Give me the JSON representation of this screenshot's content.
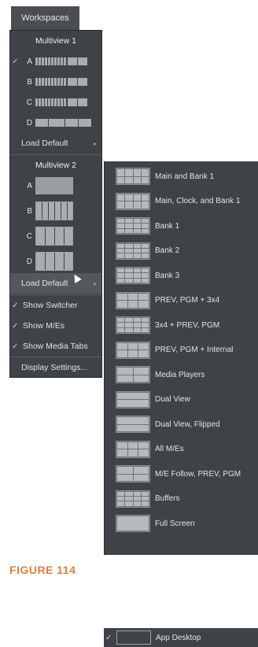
{
  "workspaces_button": "Workspaces",
  "multiview1": {
    "title": "Multiview 1",
    "rows": [
      {
        "check": "✓",
        "letter": "A"
      },
      {
        "check": "",
        "letter": "B"
      },
      {
        "check": "",
        "letter": "C"
      },
      {
        "check": "",
        "letter": "D"
      }
    ],
    "load_default": "Load Default"
  },
  "multiview2": {
    "title": "Multiview 2",
    "rows": [
      {
        "letter": "A"
      },
      {
        "letter": "B"
      },
      {
        "letter": "C"
      },
      {
        "letter": "D"
      }
    ],
    "load_default": "Load Default"
  },
  "options": [
    {
      "check": "✓",
      "label": "Show Switcher"
    },
    {
      "check": "✓",
      "label": "Show M/Es"
    },
    {
      "check": "✓",
      "label": "Show Media Tabs"
    }
  ],
  "display_settings": "Display Settings...",
  "submenu": [
    {
      "label": "Main and Bank 1"
    },
    {
      "label": "Main, Clock, and Bank 1"
    },
    {
      "label": "Bank 1"
    },
    {
      "label": "Bank 2"
    },
    {
      "label": "Bank 3"
    },
    {
      "label": "PREV, PGM + 3x4"
    },
    {
      "label": "3x4 + PREV, PGM"
    },
    {
      "label": "PREV, PGM + Internal"
    },
    {
      "label": "Media Players"
    },
    {
      "label": "Dual View"
    },
    {
      "label": "Dual View, Flipped"
    },
    {
      "label": "All M/Es"
    },
    {
      "label": "M/E Follow, PREV, PGM"
    },
    {
      "label": "Buffers"
    },
    {
      "label": "Full Screen"
    }
  ],
  "figure_caption": "FIGURE 114",
  "app_desktop": {
    "check": "✓",
    "label": "App Desktop"
  },
  "colors": {
    "caption": "#e67a3a",
    "menu_bg": "#3f4246"
  }
}
